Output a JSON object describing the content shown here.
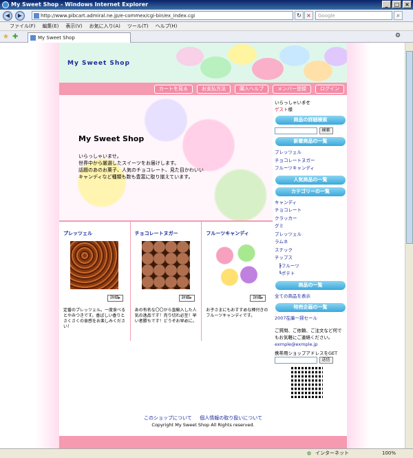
{
  "window": {
    "title": "My Sweet Shop - Windows Internet Explorer"
  },
  "browser": {
    "url": "http://www.pibcart.admiral.ne.jp/e-commex/cgi-bin/ex_index.cgi",
    "search_placeholder": "Google",
    "menu": [
      "ファイル(F)",
      "編集(E)",
      "表示(V)",
      "お気に入り(A)",
      "ツール(T)",
      "ヘルプ(H)"
    ],
    "tab_title": "My Sweet Shop",
    "status_zone": "インターネット",
    "zoom": "100%"
  },
  "site": {
    "logo": "My Sweet Shop",
    "nav": [
      "カートを見る",
      "お支払方法",
      "購入ヘルプ",
      "メンバー登録",
      "ログイン"
    ],
    "hero": {
      "title": "My Sweet Shop",
      "lines": [
        "いらっしゃいませ。",
        "世界中から厳選したスイーツをお届けします。",
        "話題のあのお菓子、人気のチョコレート、見た目かわいい",
        "キャンディなど種類も数も豊富に取り揃えています。"
      ]
    },
    "products": [
      {
        "name": "プレッツェル",
        "detail": "詳細▸",
        "desc": "定番のプレッツェル。一度食べるとやみつきです。香ばしい香りとさくさくの食感をお楽しみください！"
      },
      {
        "name": "チョコレートヌガー",
        "detail": "詳細▸",
        "desc": "あの有名な〇〇から直輸入した人気の逸品です！売り切れ必至！早い者勝ちです！どうぞお早めに。"
      },
      {
        "name": "フルーツキャンディ",
        "detail": "詳細▸",
        "desc": "お子さまにもおすすめな棒付きのフルーツキャンディです。"
      }
    ],
    "sidebar": {
      "welcome": "いらっしゃいませ",
      "guest": "ゲスト",
      "guest_suffix": "様",
      "search_head": "商品の詳細検索",
      "search_btn": "検索",
      "new_head": "新着商品の一覧",
      "new_items": [
        "プレッツェル",
        "チョコレートヌガー",
        "フルーツキャンディ"
      ],
      "popular_head": "人気商品の一覧",
      "category_head": "カテゴリーの一覧",
      "categories": [
        "キャンディ",
        "チョコレート",
        "クラッカー",
        "グミ",
        "プレッツェル",
        "ラムネ",
        "スナック",
        "チップス"
      ],
      "subcategories": [
        "フルーツ",
        "ポテト"
      ],
      "products_head": "商品の一覧",
      "all_products": "全ての商品を表示",
      "special_head": "特売企画の一覧",
      "special_item": "2007在庫一掃セール",
      "contact_text": "ご質問、ご依頼、ご注文など何でもお気軽にご連絡ください。",
      "email": "exmple@exmple.jp",
      "mobile_text": "携帯用ショップアドレスをGET",
      "send_btn": "送信"
    },
    "footer": {
      "about": "このショップについて",
      "privacy": "個人情報の取り扱いについて",
      "copyright": "Copyright My Sweet Shop All Rights reserved."
    }
  }
}
